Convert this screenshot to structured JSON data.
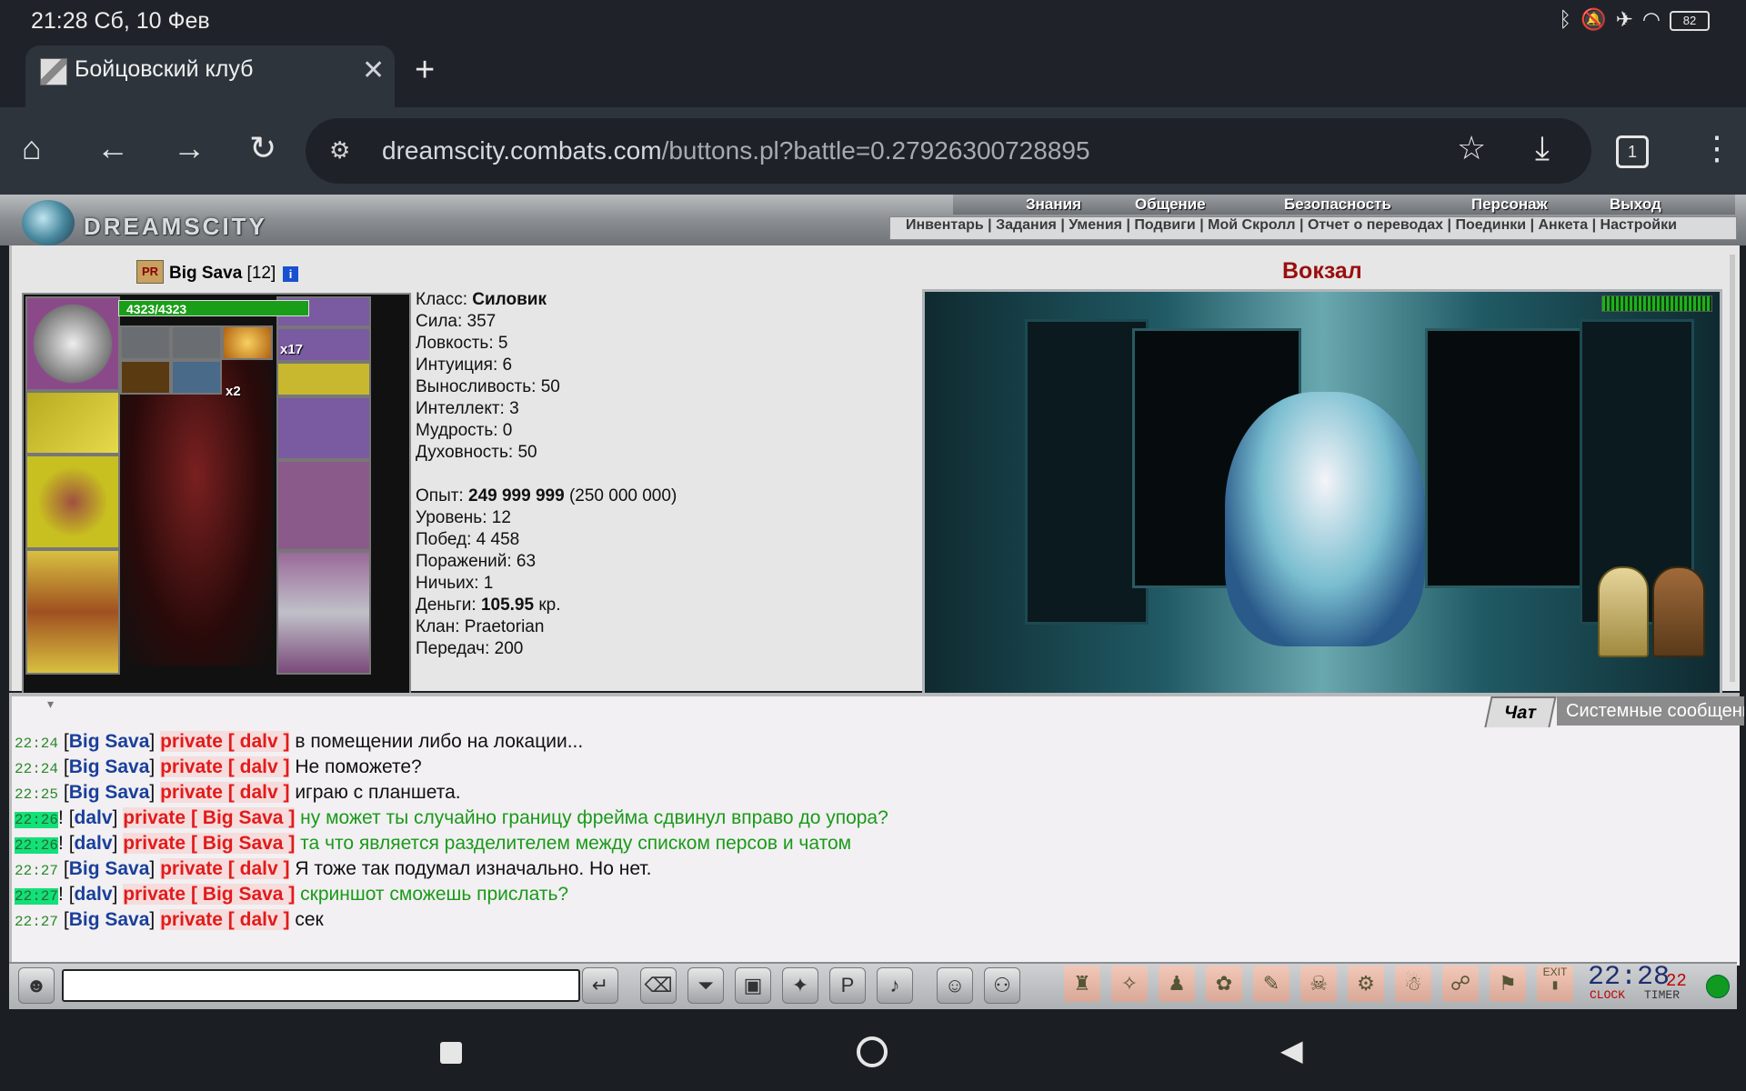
{
  "status_bar": {
    "time": "21:28 Сб, 10 Фев",
    "battery": "82",
    "icons": [
      "bluetooth-icon",
      "bell-off-icon",
      "airplane-icon",
      "wifi-icon",
      "battery-icon"
    ]
  },
  "browser": {
    "tab_title": "Бойцовский клуб",
    "url_host": "dreamscity.combats.com",
    "url_path": "/buttons.pl?battle=0.27926300728895",
    "tab_count": "1"
  },
  "game_header": {
    "logo": "DREAMSCITY",
    "top_menu": [
      "Знания",
      "Общение",
      "Безопасность",
      "Персонаж",
      "Выход"
    ],
    "sub_menu": [
      "Инвентарь",
      "Задания",
      "Умения",
      "Подвиги",
      "Мой Скролл",
      "Отчет о переводах",
      "Поединки",
      "Анкета",
      "Настройки"
    ]
  },
  "character": {
    "clan_badge": "PR",
    "name": "Big Sava",
    "level": "[12]",
    "hp": "4323/4323",
    "item_count_1": "x17",
    "item_count_2": "x2",
    "stats": {
      "class_label": "Класс:",
      "class_value": "Силовик",
      "strength": "Сила: 357",
      "agility": "Ловкость: 5",
      "intuition": "Интуиция: 6",
      "endurance": "Выносливость: 50",
      "intellect": "Интеллект: 3",
      "wisdom": "Мудрость: 0",
      "spirituality": "Духовность: 50",
      "exp_label": "Опыт:",
      "exp_value": "249 999 999",
      "exp_next": "(250 000 000)",
      "level": "Уровень: 12",
      "wins": "Побед: 4 458",
      "losses": "Поражений: 63",
      "draws": "Ничьих: 1",
      "money_label": "Деньги:",
      "money_value": "105.95",
      "money_unit": "кр.",
      "clan": "Клан: Praetorian",
      "transfers": "Передач: 200"
    }
  },
  "location": {
    "title": "Вокзал"
  },
  "chat": {
    "tabs": [
      "Чат",
      "Системные сообщения"
    ],
    "messages": [
      {
        "time": "22:24",
        "hl": false,
        "mark": "",
        "from": "Big Sava",
        "to": "dalv",
        "text": "в помещении либо на локации...",
        "incoming": false
      },
      {
        "time": "22:24",
        "hl": false,
        "mark": "",
        "from": "Big Sava",
        "to": "dalv",
        "text": "Не поможете?",
        "incoming": false
      },
      {
        "time": "22:25",
        "hl": false,
        "mark": "",
        "from": "Big Sava",
        "to": "dalv",
        "text": "играю с планшета.",
        "incoming": false
      },
      {
        "time": "22:26",
        "hl": true,
        "mark": "!",
        "from": "dalv",
        "to": "Big Sava",
        "text": "ну может ты случайно границу фрейма сдвинул вправо до упора?",
        "incoming": true
      },
      {
        "time": "22:26",
        "hl": true,
        "mark": "!",
        "from": "dalv",
        "to": "Big Sava",
        "text": "та что является разделителем между списком персов и чатом",
        "incoming": true
      },
      {
        "time": "22:27",
        "hl": false,
        "mark": "",
        "from": "Big Sava",
        "to": "dalv",
        "text": "Я тоже так подумал изначально. Но нет.",
        "incoming": false
      },
      {
        "time": "22:27",
        "hl": true,
        "mark": "!",
        "from": "dalv",
        "to": "Big Sava",
        "text": "скриншот сможешь прислать?",
        "incoming": true
      },
      {
        "time": "22:27",
        "hl": false,
        "mark": "",
        "from": "Big Sava",
        "to": "dalv",
        "text": "сек",
        "incoming": false
      }
    ],
    "private_word": "private",
    "input_value": ""
  },
  "clock": {
    "time": "22:28",
    "seconds": "22",
    "clock_label": "CLOCK",
    "timer_label": "TIMER",
    "exit_label": "EXIT"
  }
}
